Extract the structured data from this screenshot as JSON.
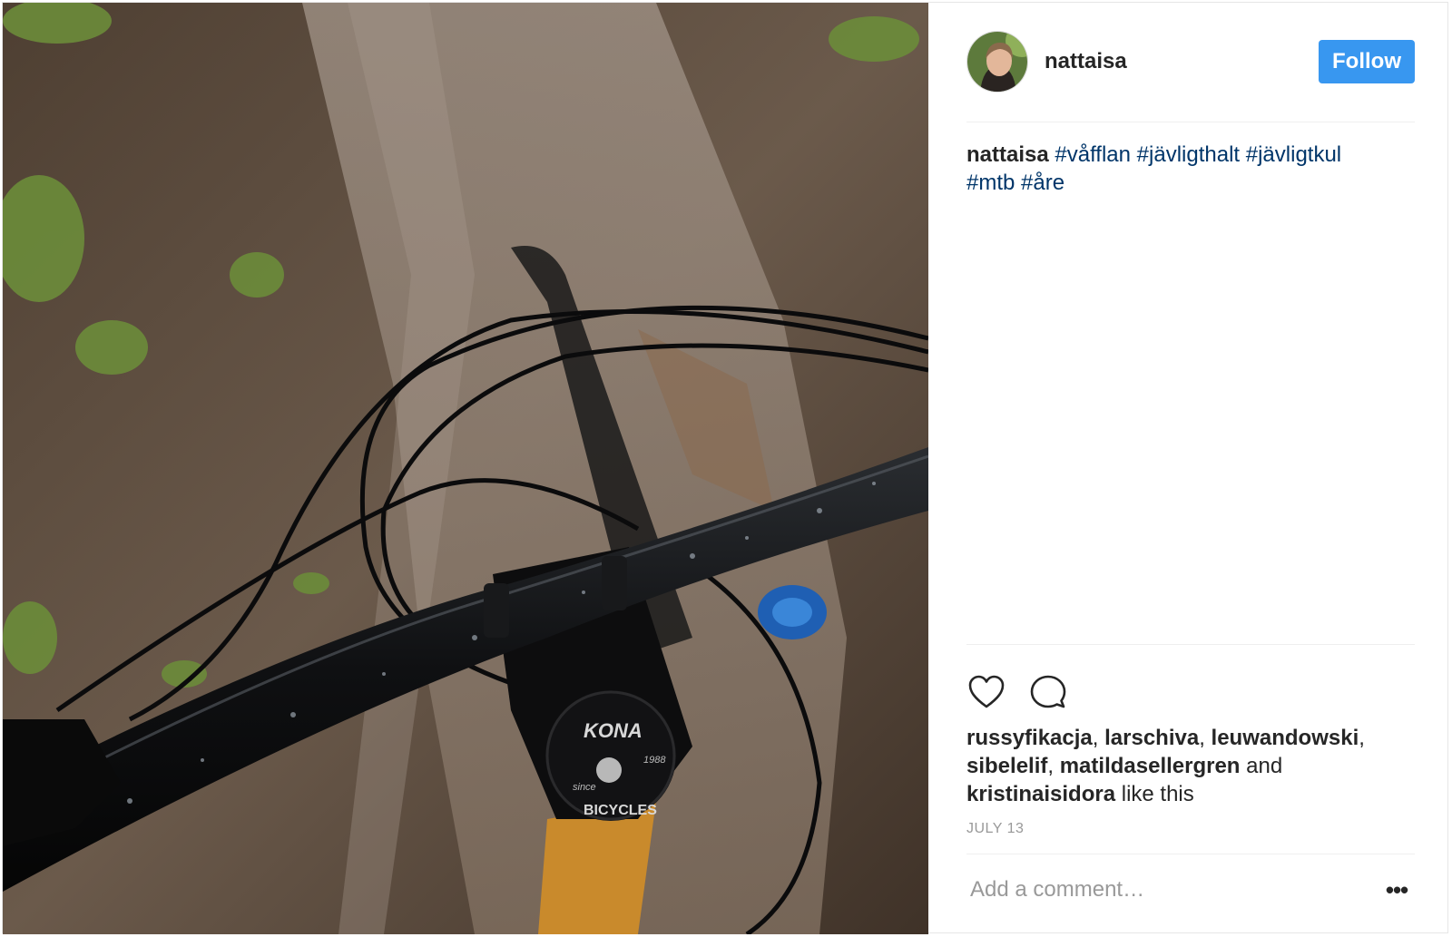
{
  "post": {
    "username": "nattaisa",
    "follow_label": "Follow",
    "caption": {
      "user": "nattaisa",
      "tags": [
        "#våfflan",
        "#jävligthalt",
        "#jävligtkul",
        "#mtb",
        "#åre"
      ]
    },
    "photo_text": {
      "headset_brand": "KONA",
      "headset_line": "BICYCLES",
      "headset_since": "since",
      "headset_year": "1988"
    },
    "likes": {
      "users": [
        "russyfikacja",
        "larschiva",
        "leuwandowski",
        "sibelelif",
        "matildasellergren"
      ],
      "last_user": "kristinaisidora",
      "and_word": "and",
      "suffix": "like this"
    },
    "date": "JULY 13",
    "comment_placeholder": "Add a comment…",
    "more_label": "•••"
  },
  "colors": {
    "follow_bg": "#3897f0",
    "hashtag": "#003569",
    "muted": "#999999",
    "text": "#262626"
  },
  "icons": [
    "heart-icon",
    "comment-icon",
    "more-options-icon"
  ]
}
